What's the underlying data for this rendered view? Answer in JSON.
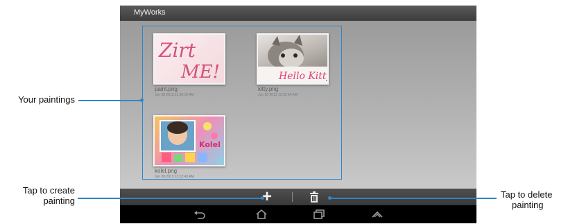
{
  "app": {
    "title": "MyWorks"
  },
  "gallery": {
    "items": [
      {
        "filename": "paint.png",
        "date": "Jun 28 2013 11:30:18 AM",
        "thumbnail": "handwritten-text"
      },
      {
        "filename": "kitty.png",
        "date": "Jun 28 2013 12:30:54 AM",
        "thumbnail": "kitten-photo"
      },
      {
        "filename": "kolel.png",
        "date": "Jun 28 2013 11:12:43 AM",
        "thumbnail": "child-collage"
      }
    ],
    "paint_text_line1": "Zirt",
    "paint_text_line2": "ME!",
    "kitty_overlay_text": "Hello Kitty",
    "kolel_overlay_text": "Kolel"
  },
  "action_bar": {
    "create_icon": "plus-icon",
    "delete_icon": "trash-icon"
  },
  "nav_bar": {
    "icons": [
      "back-icon",
      "home-icon",
      "recent-apps-icon",
      "menu-up-icon"
    ]
  },
  "callouts": {
    "paintings_label": "Your paintings",
    "create_label_line1": "Tap to create",
    "create_label_line2": "painting",
    "delete_label_line1": "Tap to delete",
    "delete_label_line2": "painting"
  },
  "colors": {
    "callout_line": "#2f85c8",
    "title_bar": "#4a4a4a",
    "content_bg": "#b0b0b0",
    "paint_ink": "#d4507a"
  }
}
